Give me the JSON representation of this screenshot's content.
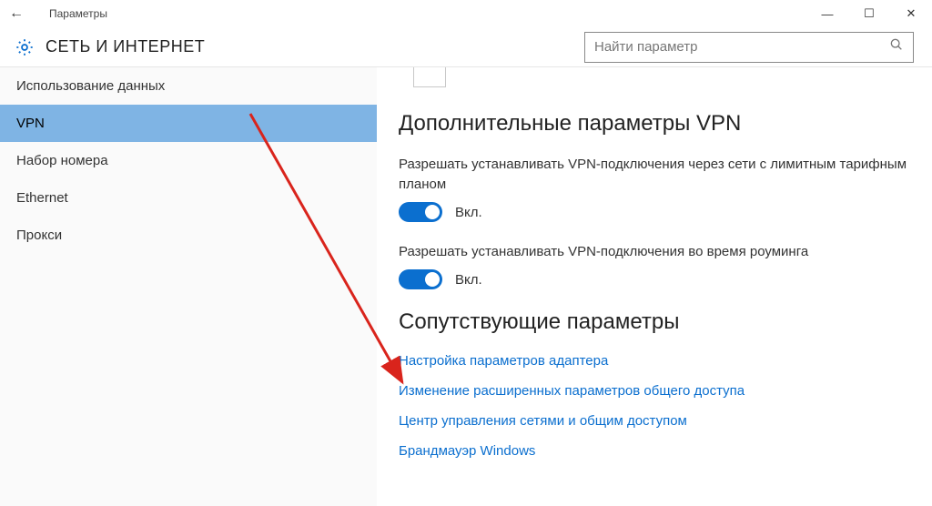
{
  "window": {
    "title": "Параметры",
    "minimize": "—",
    "maximize": "☐",
    "close": "✕"
  },
  "header": {
    "section": "СЕТЬ И ИНТЕРНЕТ"
  },
  "search": {
    "placeholder": "Найти параметр"
  },
  "sidebar": {
    "items": [
      {
        "label": "Использование данных"
      },
      {
        "label": "VPN"
      },
      {
        "label": "Набор номера"
      },
      {
        "label": "Ethernet"
      },
      {
        "label": "Прокси"
      }
    ],
    "selected_index": 1
  },
  "content": {
    "advanced_heading": "Дополнительные параметры VPN",
    "settings": {
      "metered": {
        "label": "Разрешать устанавливать VPN-подключения через сети с лимитным тарифным планом",
        "state": "Вкл."
      },
      "roaming": {
        "label": "Разрешать устанавливать VPN-подключения во время роуминга",
        "state": "Вкл."
      }
    },
    "related_heading": "Сопутствующие параметры",
    "links": {
      "adapter": "Настройка параметров адаптера",
      "sharing": "Изменение расширенных параметров общего доступа",
      "control": "Центр управления сетями и общим доступом",
      "firewall": "Брандмауэр Windows"
    }
  }
}
